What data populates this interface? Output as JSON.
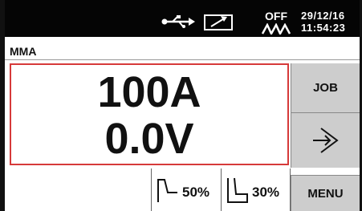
{
  "status": {
    "usb_icon": "usb-icon",
    "wire_icon": "wire-feed-icon",
    "power_state": "OFF",
    "wave_icon": "arc-wave-icon",
    "date": "29/12/16",
    "time": "11:54:23"
  },
  "mode": "MMA",
  "readout": {
    "current": "100A",
    "voltage": "0.0V",
    "border_color": "#d63a3a"
  },
  "side_buttons": {
    "job_label": "JOB",
    "enter_icon": "enter-arrow-icon",
    "menu_label": "MENU"
  },
  "params": {
    "hot_start": {
      "icon": "hot-start-icon",
      "value": "50%"
    },
    "arc_force": {
      "icon": "arc-force-icon",
      "value": "30%"
    }
  }
}
